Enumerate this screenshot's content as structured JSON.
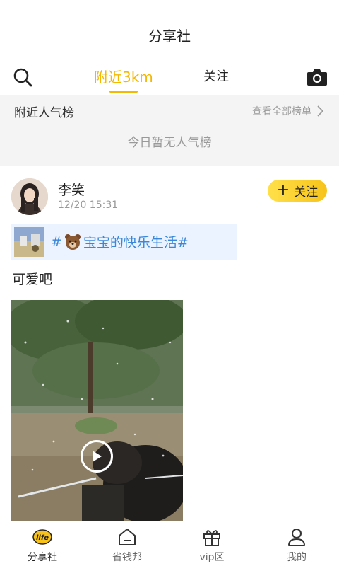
{
  "header": {
    "title": "分享社"
  },
  "tabs": {
    "nearby": "附近3km",
    "follow": "关注"
  },
  "popular": {
    "title": "附近人气榜",
    "view_all": "查看全部榜单",
    "empty_text": "今日暂无人气榜"
  },
  "post": {
    "username": "李笑",
    "time": "12/20 15:31",
    "follow_label": "关注",
    "topic_prefix": "#",
    "topic_text": "宝宝的快乐生活#",
    "content": "可爱吧"
  },
  "nav": {
    "items": [
      {
        "label": "分享社",
        "icon": "life-icon"
      },
      {
        "label": "省钱邦",
        "icon": "home-icon"
      },
      {
        "label": "vip区",
        "icon": "gift-icon"
      },
      {
        "label": "我的",
        "icon": "user-icon"
      }
    ]
  },
  "colors": {
    "accent": "#f5b800",
    "topic_text": "#3a86d8",
    "topic_bg": "#eaf3ff"
  }
}
